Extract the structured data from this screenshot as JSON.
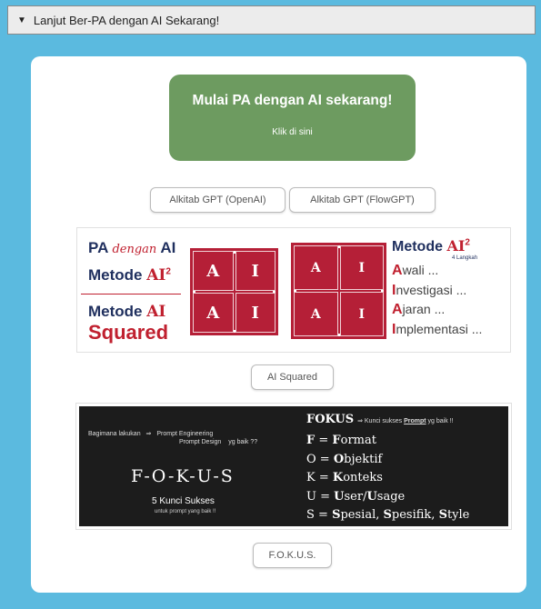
{
  "accordion": {
    "title": "Lanjut Ber-PA dengan AI Sekarang!"
  },
  "cta": {
    "title": "Mulai PA dengan AI sekarang!",
    "subtitle": "Klik di sini"
  },
  "buttons": {
    "openai": "Alkitab GPT (OpenAI)",
    "flowgpt": "Alkitab GPT (FlowGPT)",
    "ai_squared": "AI Squared",
    "fokus": "F.O.K.U.S."
  },
  "ai_card": {
    "pa": "PA",
    "dengan": "dengan",
    "ai": "AI",
    "metode": "Metode",
    "ai2": "AI",
    "sup": "2",
    "squared": "Squared",
    "grid_a": "A",
    "grid_i": "I",
    "right_title": "Metode",
    "right_ai": "AI",
    "right_sup": "2",
    "langkah": "4 Langkah",
    "steps": [
      {
        "letter": "A",
        "rest": "wali ..."
      },
      {
        "letter": "I",
        "rest": "nvestigasi ..."
      },
      {
        "letter": "A",
        "rest": "jaran ..."
      },
      {
        "letter": "I",
        "rest": "mplementasi ..."
      }
    ]
  },
  "fokus_card": {
    "q_left": "Bagimana lakukan",
    "arrow": "⇒",
    "q_right1": "Prompt Engineering",
    "q_right2": "Prompt Design",
    "q_right3": "yg baik ??",
    "word": "F-O-K-U-S",
    "kunci": "5 Kunci Sukses",
    "untuk": "untuk prompt yang baik !!",
    "head": "FOKUS",
    "head_note_pre": "⇒ Kunci sukses",
    "head_note_u": "Prompt",
    "head_note_post": "yg baik !!",
    "rows": [
      {
        "k": "F",
        "b": "F",
        "r": "ormat"
      },
      {
        "k": "O",
        "b": "O",
        "r": "bjektif"
      },
      {
        "k": "K",
        "b": "K",
        "r": "onteks"
      },
      {
        "k": "U",
        "b": "U",
        "r": "ser/",
        "b2": "U",
        "r2": "sage"
      },
      {
        "k": "S",
        "b": "S",
        "r": "pesial, ",
        "b2": "S",
        "r2": "pesifik, ",
        "b3": "S",
        "r3": "tyle"
      }
    ]
  }
}
